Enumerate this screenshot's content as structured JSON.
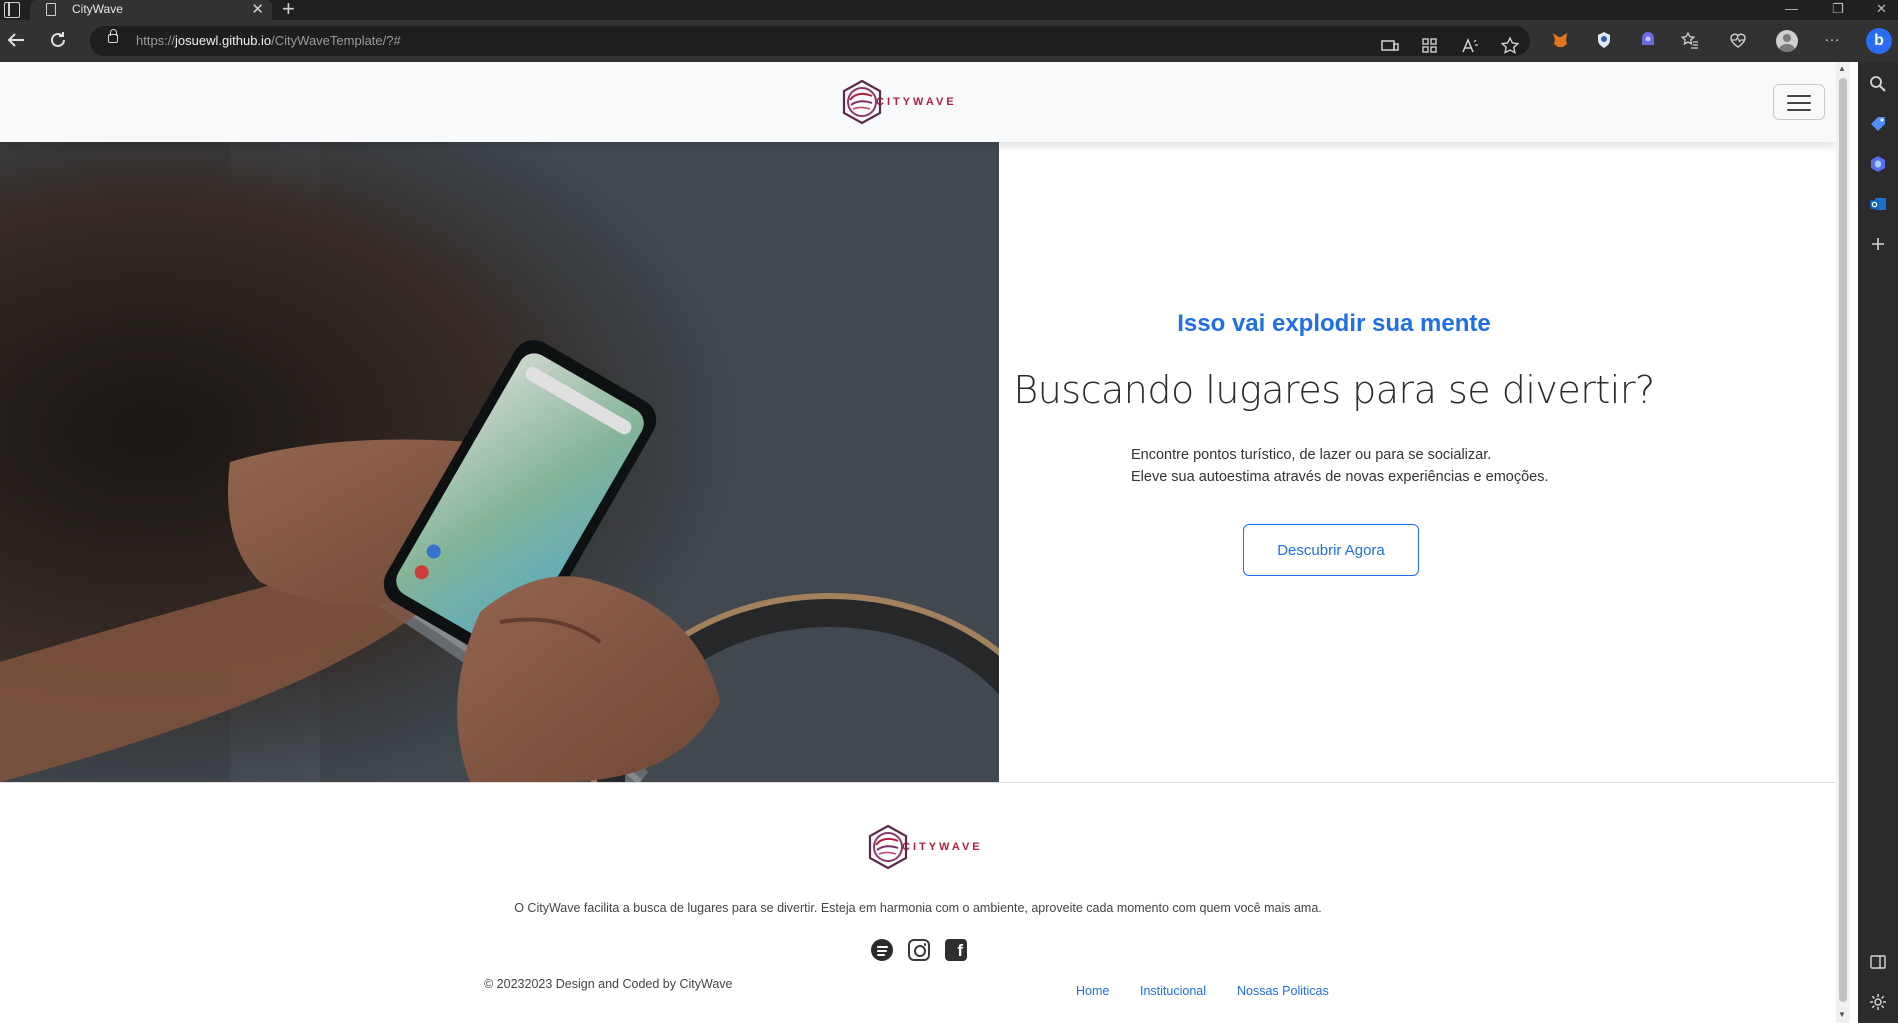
{
  "browser": {
    "tab_title": "CityWave",
    "url_prefix": "https://",
    "url_host": "josuewl.github.io",
    "url_path": "/CityWaveTemplate/?#",
    "new_tab_glyph": "+",
    "close_glyph": "✕",
    "minimize_glyph": "—",
    "restore_glyph": "❐",
    "window_close_glyph": "✕",
    "more_glyph": "···",
    "bing_letter": "b"
  },
  "site": {
    "brand_name": "CITYWAVE",
    "brand_color": "#b3203f",
    "accent_color": "#1f6fe5"
  },
  "hero": {
    "kicker": "Isso vai explodir sua mente",
    "headline": "Buscando lugares para se divertir?",
    "desc_line1": "Encontre pontos turístico, de lazer ou para se socializar.",
    "desc_line2": "Eleve sua autoestima através de novas experiências e emoções.",
    "cta": "Descubrir Agora"
  },
  "footer": {
    "brand_name": "CITYWAVE",
    "tagline": "O CityWave facilita a busca de lugares para se divertir. Esteja em harmonia com o ambiente, aproveite cada momento com quem você mais ama.",
    "copyright": "© 20232023 Design and Coded by CityWave",
    "links": [
      "Home",
      "Institucional",
      "Nossas Politicas"
    ],
    "social_icons": [
      "spotify-icon",
      "instagram-icon",
      "facebook-icon"
    ],
    "facebook_letter": "f"
  }
}
